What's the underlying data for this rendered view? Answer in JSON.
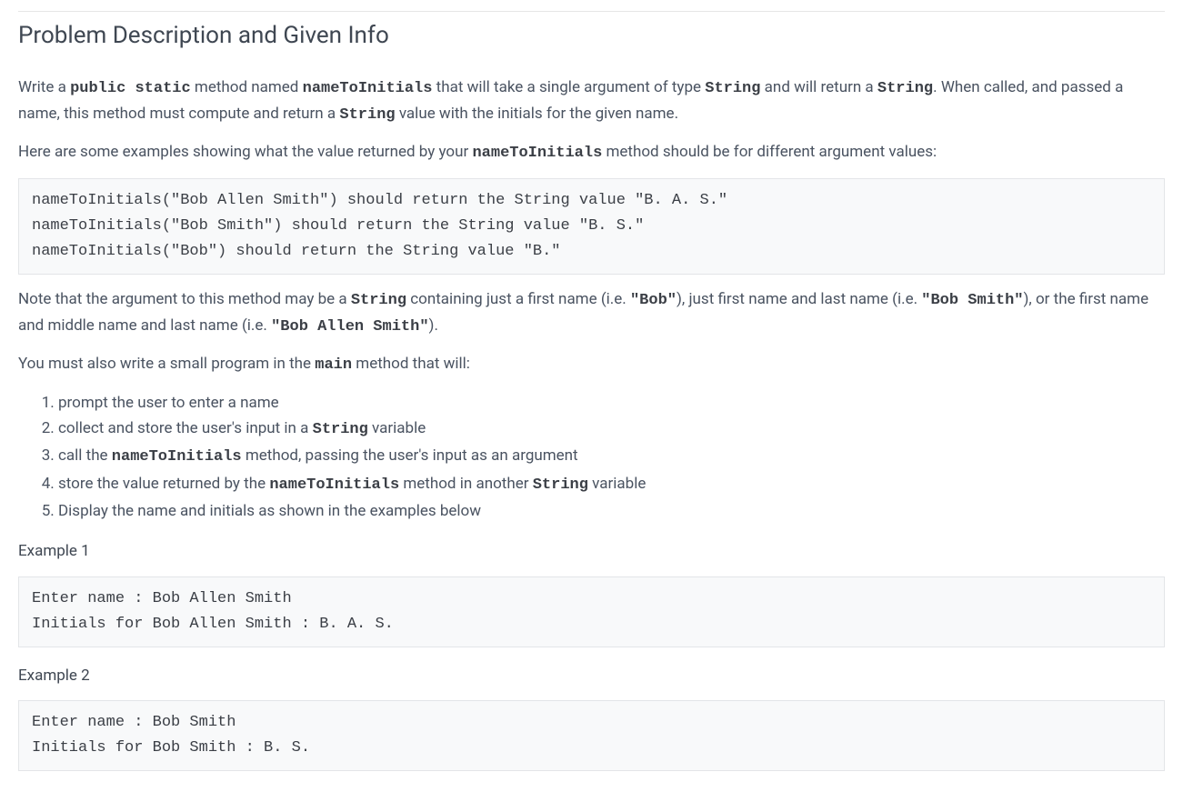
{
  "title": "Problem Description and Given Info",
  "intro": {
    "p1_pre": "Write a ",
    "c1": "public static",
    "p1_m1": " method named ",
    "c2": "nameToInitials",
    "p1_m2": " that will take a single argument of type ",
    "c3": "String",
    "p1_m3": " and will return a ",
    "c4": "String",
    "p1_m4": ". When called, and passed a name, this method must compute and return a ",
    "c5": "String",
    "p1_end": " value with the initials for the given name."
  },
  "examples_lead": {
    "pre": "Here are some examples showing what the value returned by your ",
    "c": "nameToInitials",
    "post": " method should be for different argument values:"
  },
  "code_block1": "nameToInitials(\"Bob Allen Smith\") should return the String value \"B. A. S.\"\nnameToInitials(\"Bob Smith\") should return the String value \"B. S.\"\nnameToInitials(\"Bob\") should return the String value \"B.\"",
  "note": {
    "t1": "Note that the argument to this method may be a ",
    "c1": "String",
    "t2": " containing just a first name (i.e. ",
    "c2": "\"Bob\"",
    "t3": "), just first name and last name (i.e. ",
    "c3": "\"Bob Smith\"",
    "t4": "), or the first name and middle name and last name (i.e. ",
    "c4": "\"Bob Allen Smith\"",
    "t5": ")."
  },
  "mainreq": {
    "t1": "You must also write a small program in the ",
    "c1": "main",
    "t2": " method that will:"
  },
  "steps": [
    {
      "pre": "prompt the user to enter a name"
    },
    {
      "pre": "collect and store the user's input in a ",
      "c1": "String",
      "post": " variable"
    },
    {
      "pre": "call the ",
      "c1": "nameToInitials",
      "post": " method, passing the user's input as an argument"
    },
    {
      "pre": "store the value returned by the ",
      "c1": "nameToInitials",
      "mid": " method in another ",
      "c2": "String",
      "post": " variable"
    },
    {
      "pre": "Display the name and initials as shown in the examples below"
    }
  ],
  "ex1_label": "Example 1",
  "ex1_block": "Enter name : Bob Allen Smith\nInitials for Bob Allen Smith : B. A. S.",
  "ex2_label": "Example 2",
  "ex2_block": "Enter name : Bob Smith\nInitials for Bob Smith : B. S."
}
